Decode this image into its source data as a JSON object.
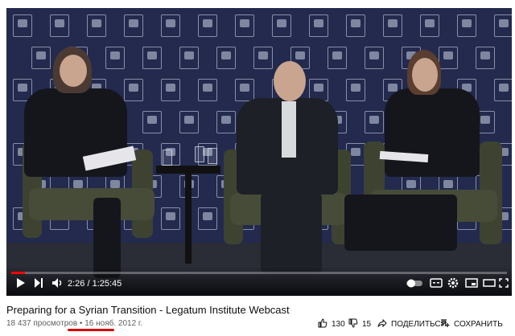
{
  "video": {
    "title": "Preparing for a Syrian Transition - Legatum Institute Webcast",
    "views": "18 437 просмотров",
    "separator": "•",
    "date": "16 нояб. 2012 г.",
    "progress_fraction": 0.0268,
    "time_current": "2:26",
    "time_sep": " / ",
    "time_total": "1:25:45"
  },
  "actions": {
    "likes": "130",
    "dislikes": "15",
    "share_label": "ПОДЕЛИТЬСЯ",
    "save_label": "СОХРАНИТЬ"
  },
  "icons": {
    "play": "play-icon",
    "next": "next-icon",
    "volume": "volume-icon",
    "autoplay": "autoplay-toggle-icon",
    "subtitles": "subtitles-icon",
    "settings": "settings-icon",
    "miniplayer": "miniplayer-icon",
    "theater": "theater-icon",
    "fullscreen": "fullscreen-icon",
    "like": "thumbs-up-icon",
    "dislike": "thumbs-down-icon",
    "share": "share-icon",
    "save": "save-playlist-icon"
  },
  "colors": {
    "progress": "#ff0000",
    "annotation_underline": "#d40000"
  }
}
